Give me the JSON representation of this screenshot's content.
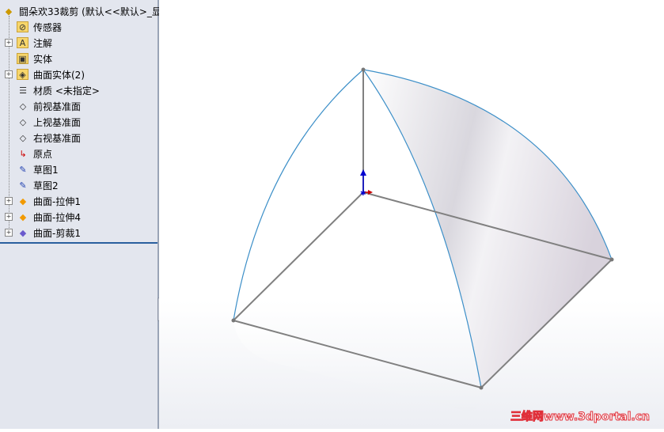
{
  "tree": {
    "root": "闘朵欢33裁剪 (默认<<默认>_显",
    "items": [
      {
        "label": "传感器",
        "icon": "sensor-folder-icon",
        "expand": false
      },
      {
        "label": "注解",
        "icon": "annotation-folder-icon",
        "expand": true
      },
      {
        "label": "实体",
        "icon": "solid-body-folder-icon",
        "expand": false
      },
      {
        "label": "曲面实体(2)",
        "icon": "surface-body-folder-icon",
        "expand": true
      },
      {
        "label": "材质 <未指定>",
        "icon": "material-icon",
        "expand": false
      },
      {
        "label": "前视基准面",
        "icon": "plane-icon",
        "expand": false
      },
      {
        "label": "上视基准面",
        "icon": "plane-icon",
        "expand": false
      },
      {
        "label": "右视基准面",
        "icon": "plane-icon",
        "expand": false
      },
      {
        "label": "原点",
        "icon": "origin-icon",
        "expand": false
      },
      {
        "label": "草图1",
        "icon": "sketch-icon",
        "expand": false
      },
      {
        "label": "草图2",
        "icon": "sketch-icon",
        "expand": false
      },
      {
        "label": "曲面-拉伸1",
        "icon": "surface-extrude-icon",
        "expand": true
      },
      {
        "label": "曲面-拉伸4",
        "icon": "surface-extrude-icon",
        "expand": true
      },
      {
        "label": "曲面-剪裁1",
        "icon": "surface-trim-icon",
        "expand": true
      }
    ]
  },
  "watermark": "三维网www.3dportal.cn"
}
